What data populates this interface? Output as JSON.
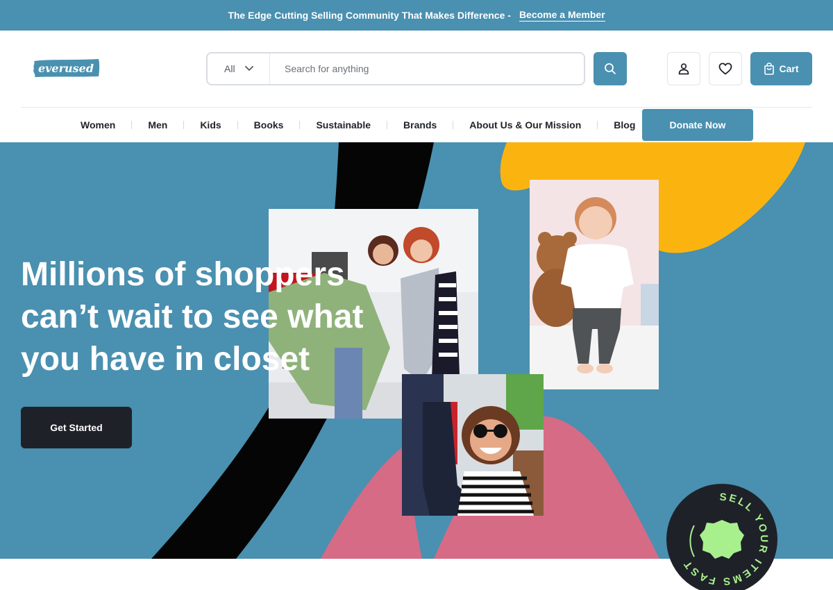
{
  "announcement": {
    "message": "The Edge Cutting Selling Community That Makes Difference -",
    "link_label": "Become a Member"
  },
  "header": {
    "logo_text": "everused",
    "search": {
      "category": "All",
      "placeholder": "Search for anything"
    },
    "cart_label": "Cart"
  },
  "nav": {
    "items": [
      {
        "label": "Women"
      },
      {
        "label": "Men"
      },
      {
        "label": "Kids"
      },
      {
        "label": "Books"
      },
      {
        "label": "Sustainable"
      },
      {
        "label": "Brands"
      },
      {
        "label": "About Us & Our Mission"
      },
      {
        "label": "Blog"
      }
    ],
    "donate_label": "Donate Now"
  },
  "hero": {
    "headline": "Millions of shoppers can’t wait to see what you have in closet",
    "cta_label": "Get Started",
    "badge_text": "SELL YOUR ITEMS FAST"
  },
  "colors": {
    "brand": "#4a90b0",
    "dark": "#1f2129",
    "yellow": "#fbb40f",
    "pink": "#d66b86",
    "badge_green": "#a8f08e"
  },
  "icons": {
    "search": "search-icon",
    "account": "user-icon",
    "wishlist": "heart-icon",
    "cart": "shopping-bag-icon",
    "category": "chevron-down-icon"
  }
}
